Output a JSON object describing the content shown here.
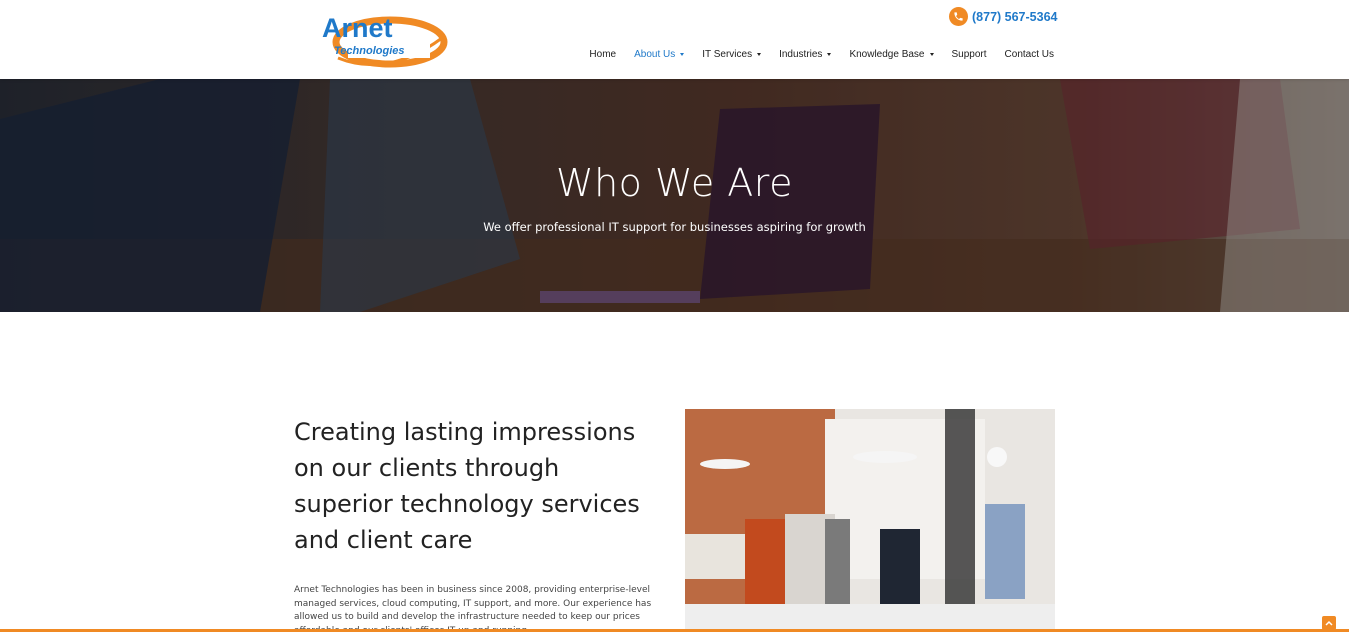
{
  "brand": {
    "logo_main": "Arnet",
    "logo_sub": "Technologies",
    "accent": "#f08a24",
    "link_blue": "#1f79c9"
  },
  "header": {
    "phone": "(877) 567-5364",
    "phone_icon": "phone-icon",
    "nav": [
      {
        "label": "Home",
        "dropdown": false,
        "active": false
      },
      {
        "label": "About Us",
        "dropdown": true,
        "active": true
      },
      {
        "label": "IT Services",
        "dropdown": true,
        "active": false
      },
      {
        "label": "Industries",
        "dropdown": true,
        "active": false
      },
      {
        "label": "Knowledge Base",
        "dropdown": true,
        "active": false
      },
      {
        "label": "Support",
        "dropdown": false,
        "active": false
      },
      {
        "label": "Contact Us",
        "dropdown": false,
        "active": false
      }
    ]
  },
  "hero": {
    "title": "Who We Are",
    "subtitle": "We offer professional IT support for businesses aspiring for growth"
  },
  "main": {
    "headline": "Creating lasting impressions on our clients through superior technology services and client care",
    "body": "Arnet Technologies has been in business since 2008, providing enterprise-level managed services, cloud computing, IT support, and more. Our experience has allowed us to build and develop the infrastructure needed to keep our prices affordable and our clients' offices IT up and running."
  }
}
